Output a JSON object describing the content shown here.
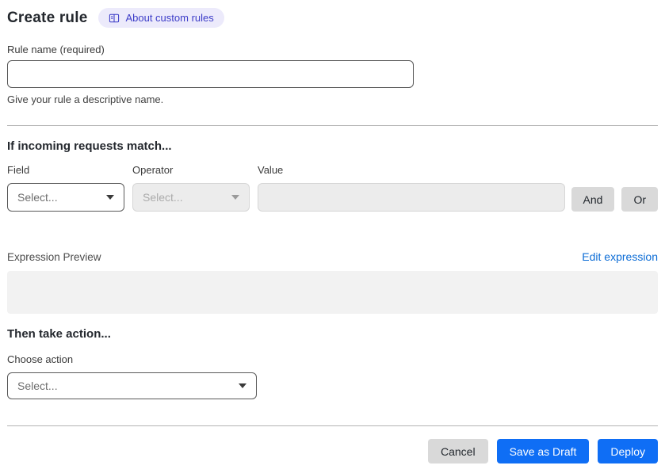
{
  "page": {
    "title": "Create rule",
    "about_badge_label": "About custom rules"
  },
  "rule_name": {
    "label": "Rule name (required)",
    "value": "",
    "helper": "Give your rule a descriptive name."
  },
  "match_section": {
    "heading": "If incoming requests match...",
    "field_label": "Field",
    "field_value": "Select...",
    "operator_label": "Operator",
    "operator_value": "Select...",
    "operator_disabled": true,
    "value_label": "Value",
    "value_value": "",
    "value_disabled": true,
    "and_button": "And",
    "or_button": "Or",
    "expression_preview_label": "Expression Preview",
    "edit_expression_link": "Edit expression",
    "expression_value": ""
  },
  "action_section": {
    "heading": "Then take action...",
    "choose_action_label": "Choose action",
    "action_value": "Select..."
  },
  "footer": {
    "cancel_label": "Cancel",
    "save_draft_label": "Save as Draft",
    "deploy_label": "Deploy"
  },
  "colors": {
    "primary_blue": "#0f6ef5",
    "link_blue": "#0d6dd6",
    "badge_bg": "#eceafb",
    "badge_text": "#3c3cc8",
    "disabled_bg": "#ececec",
    "disabled_border": "#d6d6d6",
    "neutral_btn_bg": "#d9d9d9",
    "dark_text": "#24282e"
  }
}
